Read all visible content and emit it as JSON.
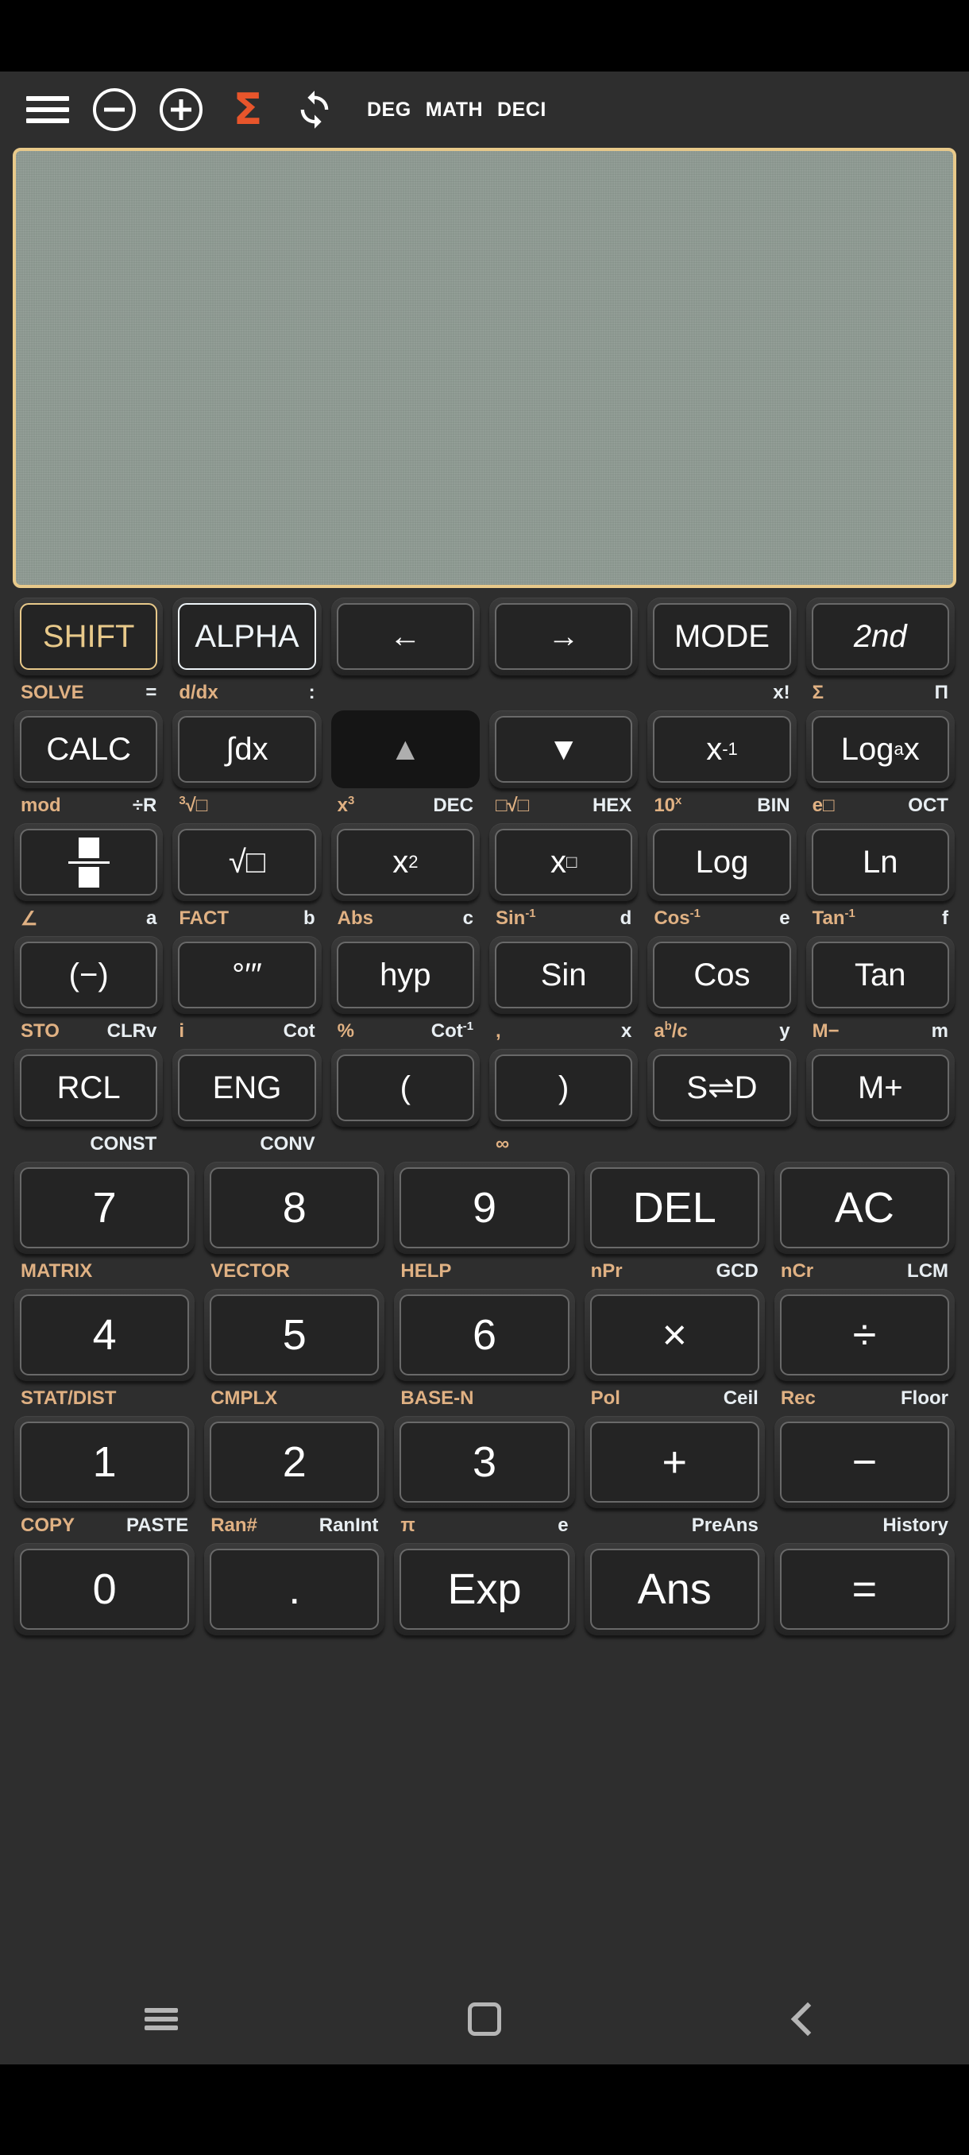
{
  "app": {
    "title": "Scientific Calculator",
    "accent_gold": "#e8c98a",
    "accent_orange": "#e8552b",
    "display_bg": "#8e9a92"
  },
  "toolbar": {
    "menu_icon": "hamburger-icon",
    "zoom_out_icon": "minus-circle-icon",
    "zoom_in_icon": "plus-circle-icon",
    "sigma_icon": "sigma-icon",
    "refresh_icon": "refresh-icon",
    "angle_mode": "DEG",
    "input_mode": "MATH",
    "number_mode": "DECI"
  },
  "display": {
    "expression": "",
    "result": ""
  },
  "keypad": {
    "rows": [
      {
        "keys": [
          {
            "label": "SHIFT",
            "style": "shift"
          },
          {
            "label": "ALPHA",
            "style": "alpha"
          },
          {
            "label": "←",
            "style": "plain"
          },
          {
            "label": "→",
            "style": "plain"
          },
          {
            "label": "MODE",
            "style": "plain"
          },
          {
            "label": "2nd",
            "style": "italic"
          }
        ],
        "labels": [
          {
            "left": "SOLVE",
            "right": "="
          },
          {
            "left": "d/dx",
            "right": ":"
          },
          {
            "left": "",
            "right": ""
          },
          {
            "left": "",
            "right": ""
          },
          {
            "left": "",
            "right": "x!"
          },
          {
            "left": "Σ",
            "right": "Π"
          }
        ]
      },
      {
        "keys": [
          {
            "label": "CALC",
            "style": "plain"
          },
          {
            "label": "∫dx",
            "style": "plain"
          },
          {
            "label": "▲",
            "style": "pressed"
          },
          {
            "label": "▼",
            "style": "plain"
          },
          {
            "label": "x⁻¹",
            "style": "sup",
            "base": "x",
            "sup": "-1"
          },
          {
            "label": "Logₐx",
            "style": "subsup",
            "base": "Log",
            "sub": "a",
            "tail": "x"
          }
        ],
        "labels": [
          {
            "left": "mod",
            "right": "÷R"
          },
          {
            "left": "³√□",
            "right": ""
          },
          {
            "left": "x³",
            "right": "DEC"
          },
          {
            "left": "□√□",
            "right": "HEX"
          },
          {
            "left": "10ˣ",
            "right": "BIN"
          },
          {
            "left": "e□",
            "right": "OCT"
          }
        ]
      },
      {
        "keys": [
          {
            "label": "fraction",
            "style": "frac"
          },
          {
            "label": "√□",
            "style": "plain"
          },
          {
            "label": "x²",
            "style": "sup",
            "base": "x",
            "sup": "2"
          },
          {
            "label": "x□",
            "style": "sup",
            "base": "x",
            "sup": "□"
          },
          {
            "label": "Log",
            "style": "plain"
          },
          {
            "label": "Ln",
            "style": "plain"
          }
        ],
        "labels": [
          {
            "left": "∠",
            "right": "a"
          },
          {
            "left": "FACT",
            "right": "b"
          },
          {
            "left": "Abs",
            "right": "c"
          },
          {
            "left": "Sin⁻¹",
            "right": "d"
          },
          {
            "left": "Cos⁻¹",
            "right": "e"
          },
          {
            "left": "Tan⁻¹",
            "right": "f"
          }
        ]
      },
      {
        "keys": [
          {
            "label": "(−)",
            "style": "plain"
          },
          {
            "label": "°′″",
            "style": "plain"
          },
          {
            "label": "hyp",
            "style": "plain"
          },
          {
            "label": "Sin",
            "style": "plain"
          },
          {
            "label": "Cos",
            "style": "plain"
          },
          {
            "label": "Tan",
            "style": "plain"
          }
        ],
        "labels": [
          {
            "left": "STO",
            "right": "CLRv"
          },
          {
            "left": "i",
            "right": "Cot"
          },
          {
            "left": "%",
            "right": "Cot⁻¹"
          },
          {
            "left": ",",
            "right": "x"
          },
          {
            "left": "aᵇ/c",
            "right": "y"
          },
          {
            "left": "M−",
            "right": "m"
          }
        ]
      },
      {
        "keys": [
          {
            "label": "RCL",
            "style": "plain"
          },
          {
            "label": "ENG",
            "style": "plain"
          },
          {
            "label": "(",
            "style": "plain"
          },
          {
            "label": ")",
            "style": "plain"
          },
          {
            "label": "S⇌D",
            "style": "plain"
          },
          {
            "label": "M+",
            "style": "plain"
          }
        ],
        "labels": [
          {
            "left": "",
            "right": "CONST"
          },
          {
            "left": "",
            "right": "CONV"
          },
          {
            "left": "",
            "right": ""
          },
          {
            "left": "∞",
            "right": ""
          },
          {
            "left": "",
            "right": ""
          },
          {
            "left": "",
            "right": ""
          }
        ]
      }
    ],
    "numrows": [
      {
        "keys": [
          "7",
          "8",
          "9",
          "DEL",
          "AC"
        ],
        "labels": [
          {
            "left": "MATRIX",
            "right": ""
          },
          {
            "left": "VECTOR",
            "right": ""
          },
          {
            "left": "HELP",
            "right": ""
          },
          {
            "left": "nPr",
            "right": "GCD"
          },
          {
            "left": "nCr",
            "right": "LCM"
          }
        ]
      },
      {
        "keys": [
          "4",
          "5",
          "6",
          "×",
          "÷"
        ],
        "labels": [
          {
            "left": "STAT/DIST",
            "right": ""
          },
          {
            "left": "CMPLX",
            "right": ""
          },
          {
            "left": "BASE-N",
            "right": ""
          },
          {
            "left": "Pol",
            "right": "Ceil"
          },
          {
            "left": "Rec",
            "right": "Floor"
          }
        ]
      },
      {
        "keys": [
          "1",
          "2",
          "3",
          "+",
          "−"
        ],
        "labels": [
          {
            "left": "COPY",
            "right": "PASTE"
          },
          {
            "left": "Ran#",
            "right": "RanInt"
          },
          {
            "left": "π",
            "right": "e"
          },
          {
            "left": "",
            "right": "PreAns"
          },
          {
            "left": "",
            "right": "History"
          }
        ]
      },
      {
        "keys": [
          "0",
          ".",
          "Exp",
          "Ans",
          "="
        ],
        "labels": [
          {
            "left": "",
            "right": ""
          },
          {
            "left": "",
            "right": ""
          },
          {
            "left": "",
            "right": ""
          },
          {
            "left": "",
            "right": ""
          },
          {
            "left": "",
            "right": ""
          }
        ]
      }
    ]
  },
  "navbar": {
    "recents_icon": "menu-lines-icon",
    "home_icon": "home-square-icon",
    "back_icon": "back-chevron-icon"
  }
}
